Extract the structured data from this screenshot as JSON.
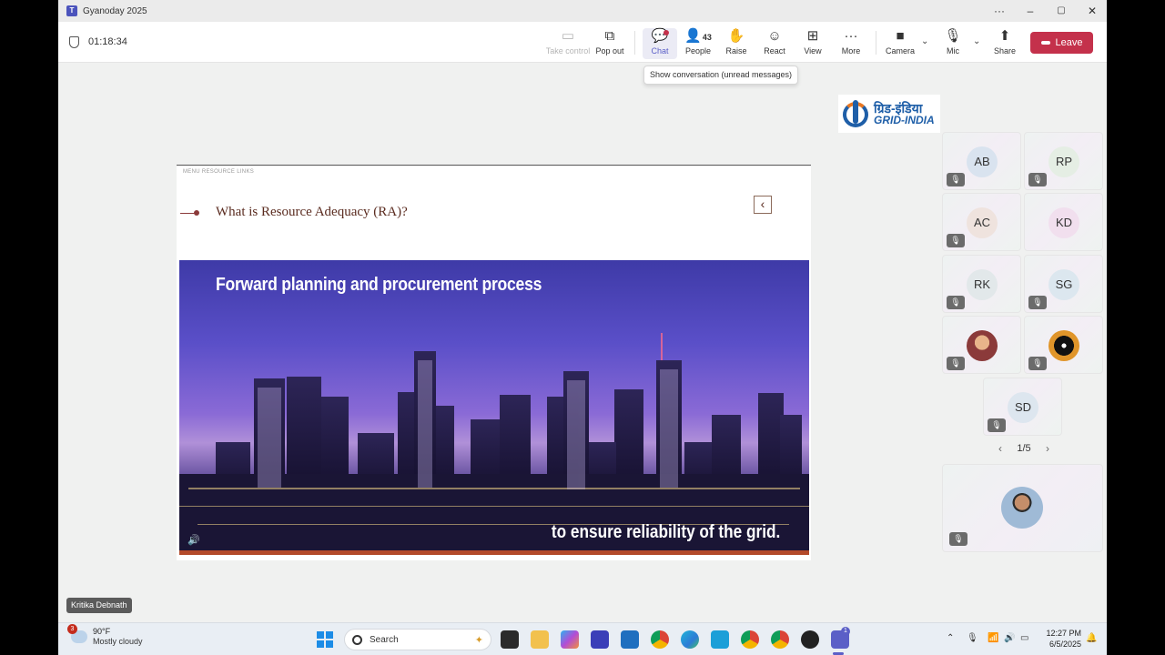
{
  "window": {
    "title": "Gyanoday 2025",
    "minimize": "–",
    "maximize": "▢",
    "close": "✕",
    "more": "···"
  },
  "toolbar": {
    "timer": "01:18:34",
    "take_control": "Take control",
    "pop_out": "Pop out",
    "chat": "Chat",
    "people": "People",
    "people_count": "43",
    "raise": "Raise",
    "react": "React",
    "view": "View",
    "more": "More",
    "camera": "Camera",
    "mic": "Mic",
    "share": "Share",
    "leave": "Leave"
  },
  "tooltip": "Show conversation (unread messages)",
  "slide": {
    "menu": "MENU   RESOURCE LINKS",
    "heading": "What is Resource Adequacy (RA)?",
    "caption_top": "Forward planning and procurement process",
    "caption_bottom": "to ensure reliability of the grid."
  },
  "logo": {
    "hindi": "ग्रिड-इंडिया",
    "english": "GRID-INDIA"
  },
  "participants": [
    "AB",
    "RP",
    "AC",
    "KD",
    "RK",
    "SG",
    "SD"
  ],
  "pager": {
    "label": "1/5",
    "prev": "‹",
    "next": "›"
  },
  "presenter_name": "Kritika Debnath",
  "taskbar": {
    "weather_badge": "3",
    "temperature": "90°F",
    "condition": "Mostly cloudy",
    "search": "Search",
    "time": "12:27 PM",
    "date": "6/5/2025",
    "teams_badge": "1"
  }
}
